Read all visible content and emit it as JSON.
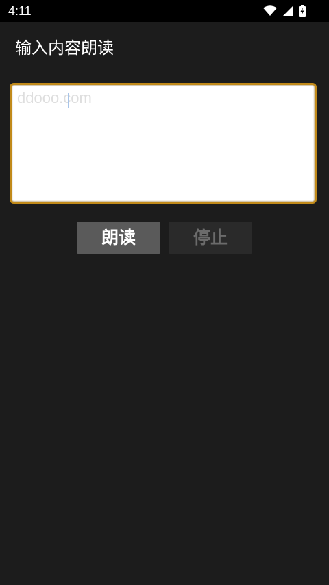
{
  "status_bar": {
    "time": "4:11",
    "icons": [
      "wifi-icon",
      "cell-signal-icon",
      "battery-icon"
    ]
  },
  "app": {
    "title": "输入内容朗读"
  },
  "input": {
    "placeholder": "ddooo.com",
    "value": ""
  },
  "buttons": {
    "read_label": "朗读",
    "stop_label": "停止"
  },
  "colors": {
    "background": "#1c1c1c",
    "input_border": "#c18a1a",
    "read_button": "#5a5a5a",
    "stop_button": "#2a2a2a"
  }
}
